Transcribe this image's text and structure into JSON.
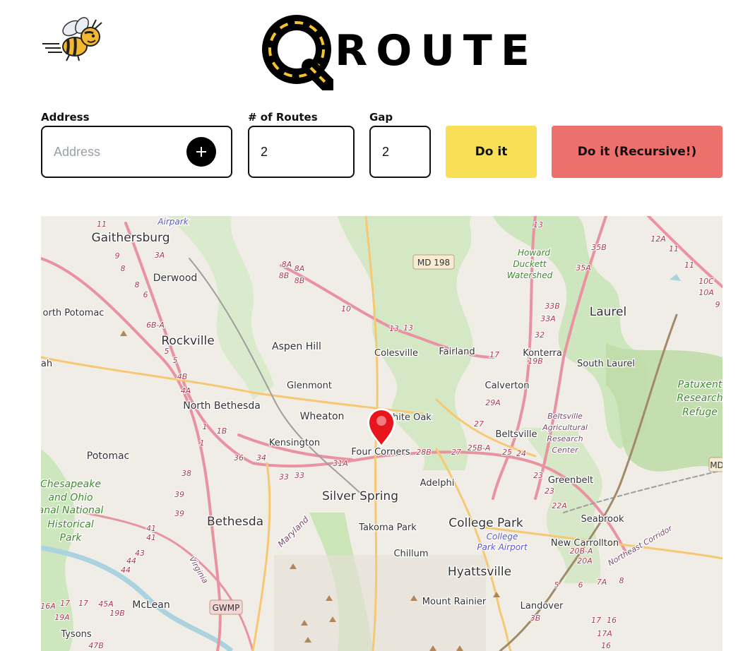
{
  "brand": {
    "text": "ROUTE"
  },
  "form": {
    "address": {
      "label": "Address",
      "placeholder": "Address",
      "value": ""
    },
    "routes": {
      "label": "# of Routes",
      "value": "2"
    },
    "gap": {
      "label": "Gap",
      "value": "2"
    },
    "do_it_label": "Do it",
    "do_it_recursive_label": "Do it (Recursive!)"
  },
  "colors": {
    "do_it_button": "#f9df55",
    "do_it_recursive_button": "#ec706c",
    "map_marker": "#e8161c"
  },
  "map": {
    "places": [
      "Gaithersburg",
      "Airpark",
      "Derwood",
      "orth Potomac",
      "Rockville",
      "Aspen Hill",
      "Colesville",
      "Fairland",
      "Konterra",
      "Laurel",
      "South Laurel",
      "Glenmont",
      "Calverton",
      "North Bethesda",
      "Wheaton",
      "White Oak",
      "Kensington",
      "Beltsville",
      "Four Corners",
      "Potomac",
      "Silver Spring",
      "Adelphi",
      "Greenbelt",
      "Bethesda",
      "Takoma Park",
      "College Park",
      "Seabrook",
      "New Carrollton",
      "Chillum",
      "Hyattsville",
      "Mount Rainier",
      "Landover",
      "McLean",
      "Tysons",
      "ah",
      "Patuxent",
      "Research",
      "Refuge",
      "Beltsville",
      "Agricultural",
      "Research",
      "Center",
      "Howard",
      "Duckett",
      "Watershed",
      "Chesapeake",
      "and Ohio",
      "anal National",
      "Historical",
      "Park",
      "College",
      "Park Airport",
      "Maryland",
      "Virginia",
      "Northeast Corridor"
    ],
    "shields": [
      "MD 198",
      "GWMP",
      "MD"
    ],
    "exits": [
      "11",
      "13",
      "12A",
      "3A",
      "9",
      "35B",
      "11",
      "8",
      "8A",
      "8A",
      "8B",
      "8B",
      "35A",
      "11",
      "8",
      "10C",
      "10A",
      "6",
      "10",
      "33B",
      "9",
      "6B-A",
      "13",
      "13",
      "33A",
      "32",
      "5",
      "17",
      "19B",
      "5",
      "4B",
      "4A",
      "29A",
      "27",
      "1",
      "1B",
      "25B-A",
      "25",
      "24",
      "1",
      "36",
      "34",
      "28B",
      "27",
      "31A",
      "23",
      "38",
      "33",
      "33",
      "23",
      "22A",
      "39",
      "39",
      "41",
      "41",
      "43",
      "44",
      "44",
      "20B-A",
      "20A",
      "5",
      "6",
      "7A",
      "8",
      "16A",
      "17",
      "17",
      "45A",
      "19A",
      "19B",
      "3B",
      "17",
      "16",
      "17A",
      "16",
      "47B"
    ]
  }
}
